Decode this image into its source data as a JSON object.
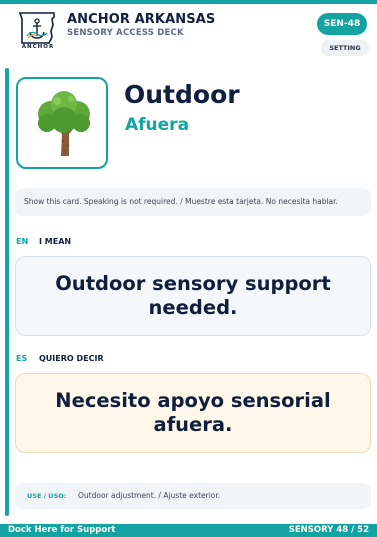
{
  "brand": {
    "logo_text": "ANCHOR",
    "name": "ANCHOR ARKANSAS",
    "subtitle": "SENSORY ACCESS DECK"
  },
  "header": {
    "code": "SEN-48",
    "setting_label": "SETTING"
  },
  "card": {
    "icon": "tree-icon",
    "title_en": "Outdoor",
    "title_es": "Afuera",
    "show_note": "Show this card. Speaking is not required. / Muestre esta tarjeta. No necesita hablar.",
    "en_tag": "EN",
    "en_label": "I MEAN",
    "en_message": "Outdoor sensory support needed.",
    "es_tag": "ES",
    "es_label": "QUIERO DECIR",
    "es_message": "Necesito apoyo sensorial afuera.",
    "use_label": "USE / USO:",
    "use_text": "Outdoor adjustment. / Ajuste exterior."
  },
  "footer": {
    "left": "Dock Here for Support",
    "right": "SENSORY 48 / 52"
  },
  "colors": {
    "accent": "#14a3a3",
    "navy": "#0f1f3d",
    "es_card_bg": "#fff8ea",
    "en_card_bg": "#f5f8fb"
  }
}
